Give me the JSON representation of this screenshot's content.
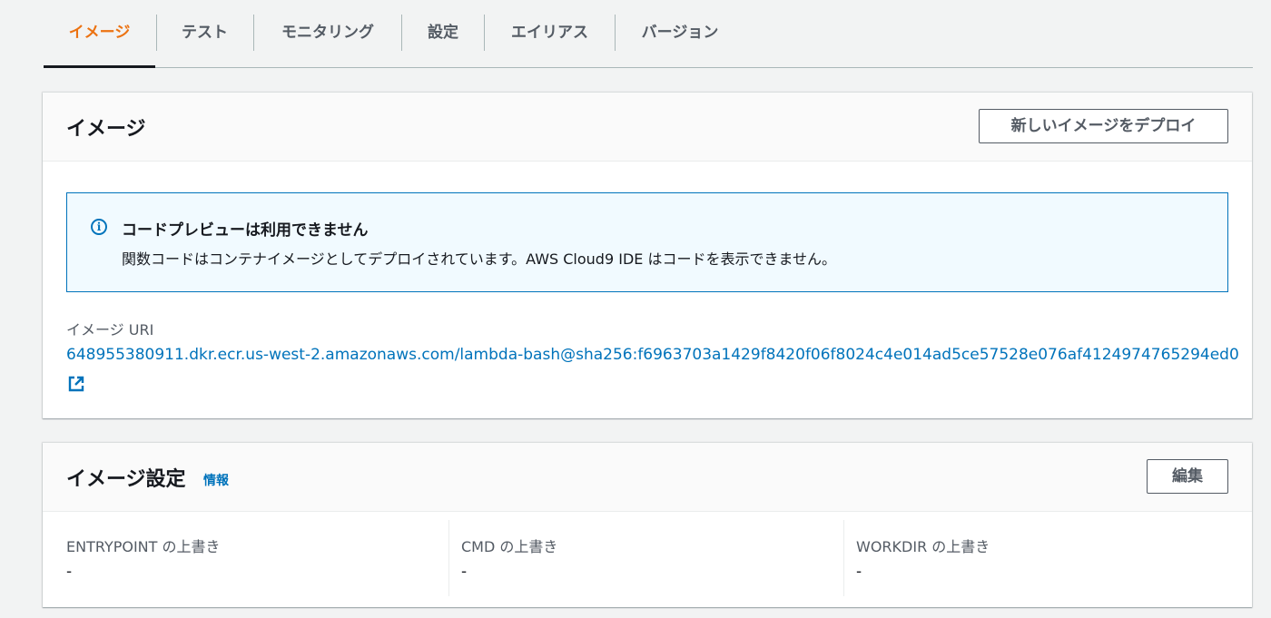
{
  "tabs": [
    {
      "label": "イメージ",
      "active": true
    },
    {
      "label": "テスト",
      "active": false
    },
    {
      "label": "モニタリング",
      "active": false
    },
    {
      "label": "設定",
      "active": false
    },
    {
      "label": "エイリアス",
      "active": false
    },
    {
      "label": "バージョン",
      "active": false
    }
  ],
  "image_panel": {
    "title": "イメージ",
    "deploy_button": "新しいイメージをデプロイ",
    "alert": {
      "icon": "info-icon",
      "title": "コードプレビューは利用できません",
      "body": "関数コードはコンテナイメージとしてデプロイされています。AWS Cloud9 IDE はコードを表示できません。"
    },
    "uri_label": "イメージ URI",
    "uri_value": "648955380911.dkr.ecr.us-west-2.amazonaws.com/lambda-bash@sha256:f6963703a1429f8420f06f8024c4e014ad5ce57528e076af4124974765294ed0",
    "external_link_icon": "external-link-icon"
  },
  "image_settings_panel": {
    "title": "イメージ設定",
    "info_link": "情報",
    "edit_button": "編集",
    "fields": [
      {
        "label": "ENTRYPOINT の上書き",
        "value": "-"
      },
      {
        "label": "CMD の上書き",
        "value": "-"
      },
      {
        "label": "WORKDIR の上書き",
        "value": "-"
      }
    ]
  },
  "colors": {
    "accent": "#ec7211",
    "link": "#0073bb",
    "background": "#f2f3f3"
  }
}
